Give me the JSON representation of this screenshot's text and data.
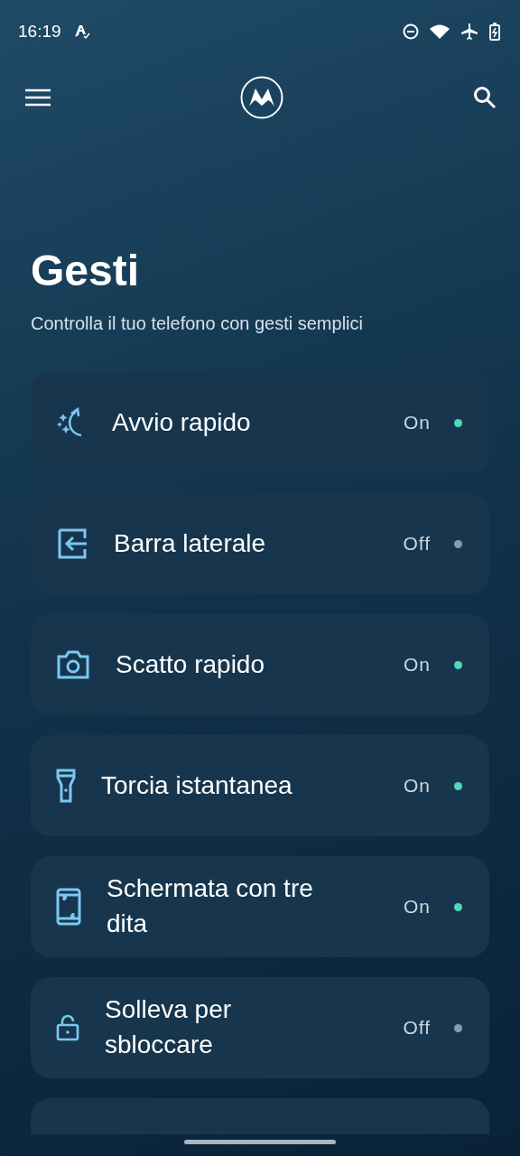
{
  "status_bar": {
    "time": "16:19"
  },
  "header": {
    "title": "Gesti",
    "subtitle": "Controlla il tuo telefono con gesti semplici"
  },
  "items": [
    {
      "kind": "quick-launch",
      "label": "Avvio rapido",
      "status": "On",
      "on": true
    },
    {
      "kind": "sidebar",
      "label": "Barra laterale",
      "status": "Off",
      "on": false
    },
    {
      "kind": "camera",
      "label": "Scatto rapido",
      "status": "On",
      "on": true
    },
    {
      "kind": "flashlight",
      "label": "Torcia istantanea",
      "status": "On",
      "on": true
    },
    {
      "kind": "screenshot",
      "label": "Schermata con tre dita",
      "status": "On",
      "on": true
    },
    {
      "kind": "lock",
      "label": "Solleva per sbloccare",
      "status": "Off",
      "on": false
    }
  ]
}
